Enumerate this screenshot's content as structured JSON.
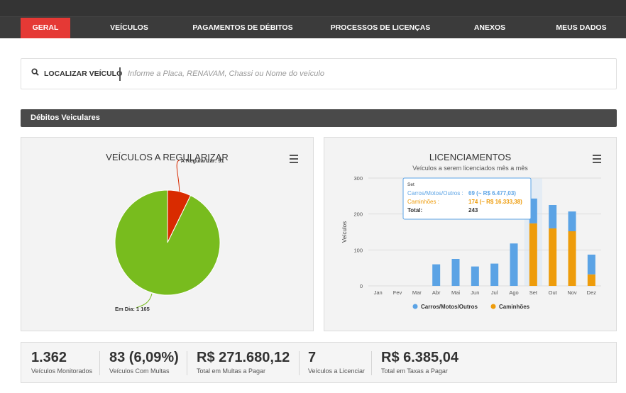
{
  "nav": {
    "items": [
      {
        "label": "GERAL",
        "active": true
      },
      {
        "label": "VEÍCULOS",
        "active": false
      },
      {
        "label": "PAGAMENTOS DE DÉBITOS",
        "active": false
      },
      {
        "label": "PROCESSOS DE LICENÇAS",
        "active": false
      },
      {
        "label": "ANEXOS",
        "active": false
      },
      {
        "label": "MEUS DADOS",
        "active": false
      }
    ]
  },
  "search": {
    "label": "LOCALIZAR VEÍCULO",
    "placeholder": "Informe a Placa, RENAVAM, Chassi ou Nome do veículo",
    "icon": "search-icon"
  },
  "section": {
    "title": "Débitos Veiculares"
  },
  "colors": {
    "accent": "#e53935",
    "green": "#78bc1e",
    "red": "#d92b00",
    "blue": "#5ba3e5",
    "orange": "#ee9c0b"
  },
  "pie_panel": {
    "title": "VEÍCULOS A REGULARIZAR",
    "menu_icon": "hamburger-menu-icon"
  },
  "bar_panel": {
    "title": "LICENCIAMENTOS",
    "subtitle": "Veículos a serem licenciados mês a mês",
    "menu_icon": "hamburger-menu-icon",
    "tooltip": {
      "header": "Set",
      "line1_label": "Carros/Motos/Outros :",
      "line1_value": "69 (~ R$ 6.477,03)",
      "line2_label": "Caminhões :",
      "line2_value": "174 (~ R$ 16.333,38)",
      "total_label": "Total:",
      "total_value": "243"
    }
  },
  "chart_data": [
    {
      "type": "pie",
      "title": "VEÍCULOS A REGULARIZAR",
      "slices": [
        {
          "label": "A Regularizar",
          "value": 91,
          "display": "A Regularizar: 91",
          "color": "#d92b00"
        },
        {
          "label": "Em Dia",
          "value": 1165,
          "display": "Em Dia: 1 165",
          "color": "#78bc1e"
        }
      ]
    },
    {
      "type": "bar",
      "stacked": true,
      "title": "LICENCIAMENTOS",
      "subtitle": "Veículos a serem licenciados mês a mês",
      "categories": [
        "Jan",
        "Fev",
        "Mar",
        "Abr",
        "Mai",
        "Jun",
        "Jul",
        "Ago",
        "Set",
        "Out",
        "Nov",
        "Dez"
      ],
      "ylabel": "Veículos",
      "ylim": [
        0,
        300
      ],
      "yticks": [
        "0",
        "100",
        "200",
        "300"
      ],
      "series": [
        {
          "name": "Carros/Motos/Outros",
          "color": "#5ba3e5",
          "values": [
            0,
            0,
            0,
            60,
            75,
            54,
            62,
            118,
            69,
            65,
            55,
            55
          ]
        },
        {
          "name": "Caminhões",
          "color": "#ee9c0b",
          "values": [
            0,
            0,
            0,
            0,
            0,
            0,
            0,
            0,
            174,
            160,
            152,
            32
          ]
        }
      ],
      "highlight_category": "Set",
      "legend": "bottom"
    }
  ],
  "stats": [
    {
      "value": "1.362",
      "label": "Veículos Monitorados"
    },
    {
      "value": "83 (6,09%)",
      "label": "Veículos Com Multas"
    },
    {
      "value": "R$ 271.680,12",
      "label": "Total em Multas a Pagar"
    },
    {
      "value": "7",
      "label": "Veículos a Licenciar"
    },
    {
      "value": "R$ 6.385,04",
      "label": "Total em Taxas a Pagar"
    }
  ]
}
